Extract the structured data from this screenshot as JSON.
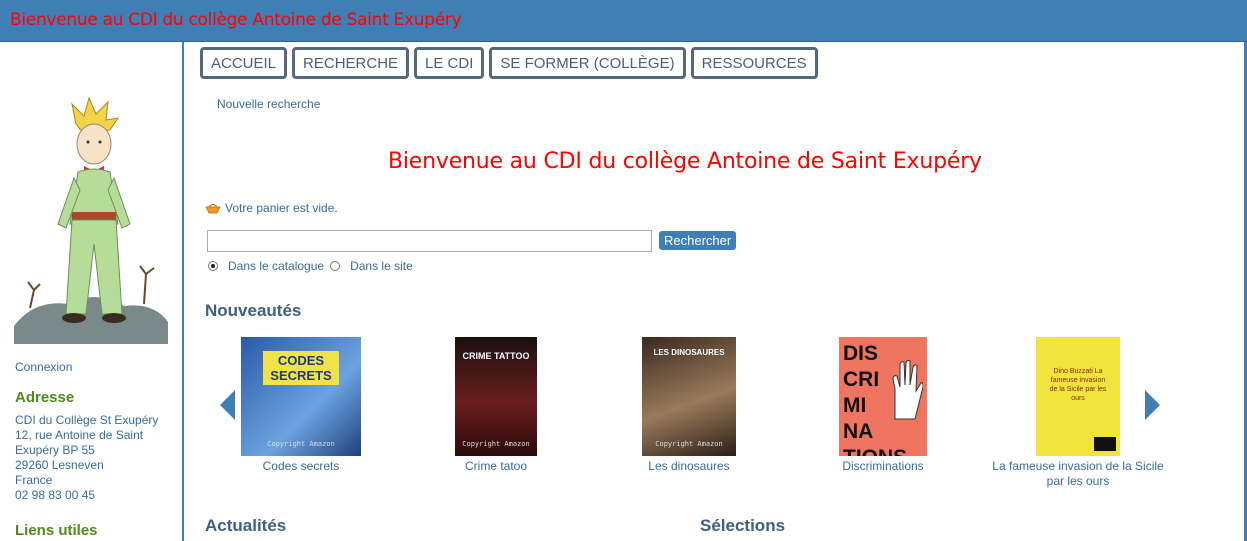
{
  "header": {
    "title": "Bienvenue au CDI du collège Antoine de Saint Exupéry"
  },
  "nav": {
    "tabs": [
      "ACCUEIL",
      "RECHERCHE",
      "LE CDI",
      "SE FORMER (COLLÈGE)",
      "RESSOURCES"
    ]
  },
  "breadcrumb": {
    "new_search": "Nouvelle recherche"
  },
  "main": {
    "headline": "Bienvenue au CDI du collège Antoine de Saint Exupéry"
  },
  "cart": {
    "status": "Votre panier est vide."
  },
  "search": {
    "value": "",
    "button": "Rechercher",
    "scope_catalog": "Dans le catalogue",
    "scope_site": "Dans le site",
    "selected_scope": "catalog"
  },
  "sidebar": {
    "login": "Connexion",
    "address_title": "Adresse",
    "address_lines": [
      "CDI du Collège St Exupéry",
      "12, rue Antoine de Saint Exupéry BP 55",
      "29260 Lesneven",
      "France",
      "02 98 83 00 45"
    ],
    "links_title": "Liens utiles"
  },
  "sections": {
    "new_items": "Nouveautés",
    "news": "Actualités",
    "selections": "Sélections"
  },
  "carousel": {
    "books": [
      {
        "title": "Codes secrets",
        "cover_text": "CODES SECRETS"
      },
      {
        "title": "Crime tatoo",
        "cover_text": "CRIME TATTOO"
      },
      {
        "title": "Les dinosaures",
        "cover_text": "LES DINOSAURES"
      },
      {
        "title": "Discriminations",
        "cover_text": "DIS CRI MI NA TIONS"
      },
      {
        "title": "La fameuse invasion de la Sicile par les ours",
        "cover_text": "Dino Buzzati La fameuse invasion de la Sicile par les ours"
      }
    ],
    "watermark": "Copyright Amazon"
  }
}
